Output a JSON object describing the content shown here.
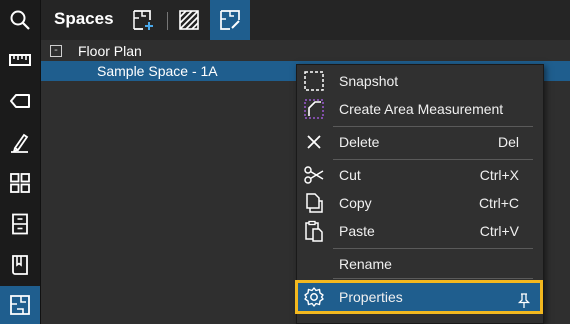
{
  "header": {
    "title": "Spaces"
  },
  "left_toolbar": {
    "tools": [
      {
        "icon": "search-icon"
      },
      {
        "icon": "ruler-icon"
      },
      {
        "icon": "tag-icon"
      },
      {
        "icon": "markup-pen-icon"
      },
      {
        "icon": "grid-view-icon"
      },
      {
        "icon": "cabinet-icon"
      },
      {
        "icon": "book-icon"
      },
      {
        "icon": "spaces-icon",
        "active": true
      }
    ]
  },
  "tree": {
    "root": {
      "label": "Floor Plan",
      "collapse_symbol": "-"
    },
    "child": {
      "label": "Sample Space - 1A",
      "selected": true
    }
  },
  "context_menu": {
    "items": [
      {
        "label": "Snapshot",
        "shortcut": "",
        "icon": "snapshot-icon"
      },
      {
        "label": "Create Area Measurement",
        "shortcut": "",
        "icon": "area-measurement-icon"
      },
      {
        "label": "Delete",
        "shortcut": "Del",
        "icon": "delete-x-icon"
      },
      {
        "label": "Cut",
        "shortcut": "Ctrl+X",
        "icon": "scissors-icon"
      },
      {
        "label": "Copy",
        "shortcut": "Ctrl+C",
        "icon": "copy-icon"
      },
      {
        "label": "Paste",
        "shortcut": "Ctrl+V",
        "icon": "paste-icon"
      },
      {
        "label": "Rename",
        "shortcut": "",
        "icon": ""
      },
      {
        "label": "Properties",
        "shortcut": "",
        "icon": "gear-icon",
        "highlighted": true
      }
    ]
  },
  "colors": {
    "accent": "#1f5e8e",
    "highlight_outline": "#f3b81f",
    "background": "#2f2f2f",
    "toolbar": "#1b1b1b"
  }
}
